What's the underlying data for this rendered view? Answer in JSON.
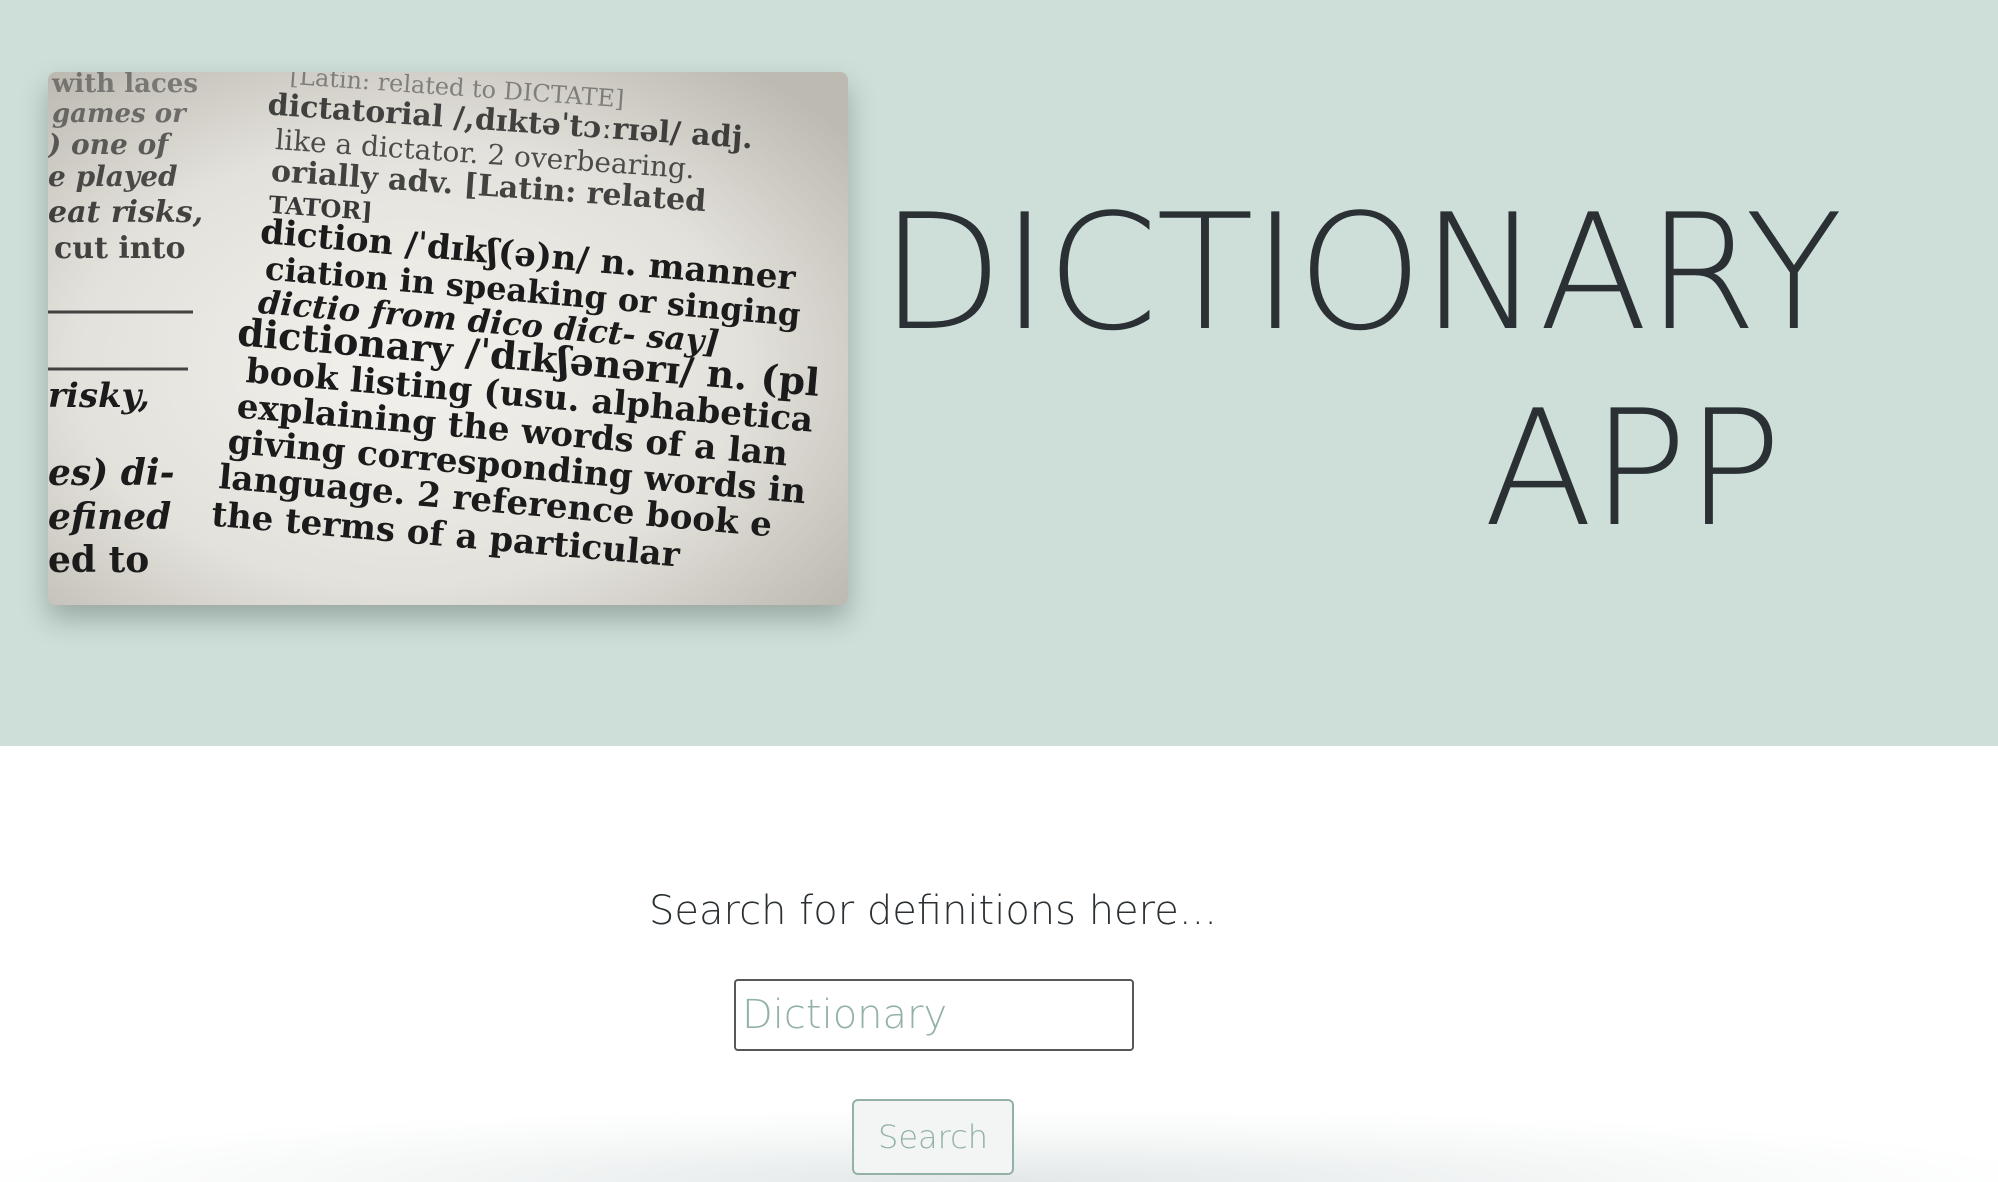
{
  "hero": {
    "title": "DICTIONARY APP",
    "image": {
      "alt": "dictionary-page-photo",
      "printed_text": [
        "[Latin: related to DICTATE]",
        "dictatorial /,dɪktəˈtɔːrɪəl/ adj.",
        "like a dictator. 2 overbearing.",
        "orially adv. [Latin: related",
        "TATOR]",
        "diction /ˈdɪkʃ(ə)n/ n. manner",
        "ciation in speaking or singing",
        "dictio from dico dict- say]",
        "dictionary /ˈdɪkʃənərɪ/ n. (pl",
        "book listing (usu. alphabetica",
        "explaining the words of a lan",
        "giving corresponding words in",
        "language. 2 reference book e",
        "the terms of a particular",
        "with laces",
        "games or",
        ") one of",
        "e played",
        "eat risks,",
        "cut into",
        "risky,",
        "es) di-",
        "efined",
        "ed to"
      ]
    }
  },
  "search": {
    "prompt": "Search for definitions here...",
    "input_placeholder": "Dictionary",
    "input_value": "",
    "button_label": "Search"
  },
  "colors": {
    "hero_background": "#cddfd8",
    "accent": "#93b1a7",
    "text": "#2a3033"
  }
}
